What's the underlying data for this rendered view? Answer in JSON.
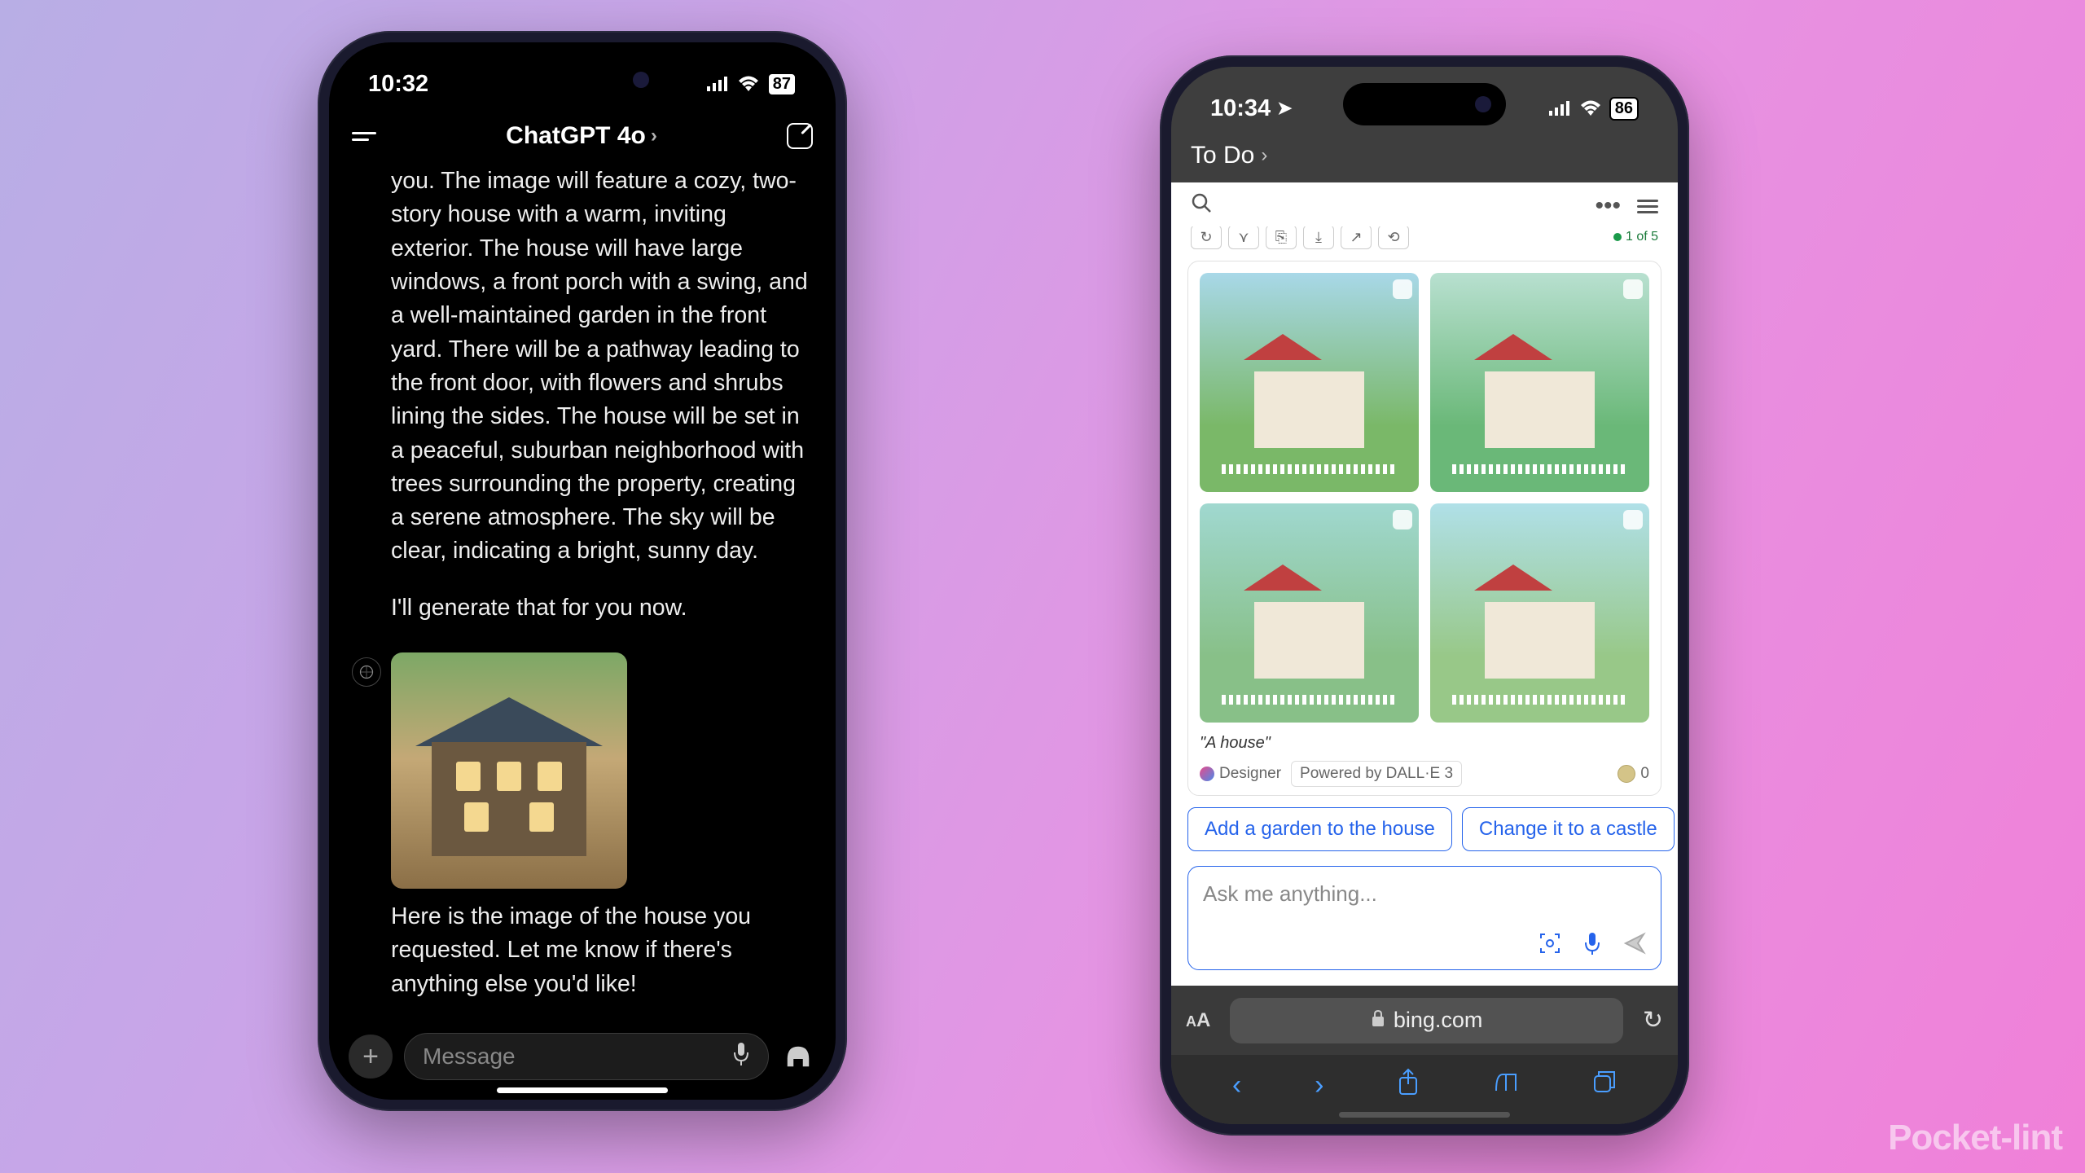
{
  "watermark": "Pocket-lint",
  "left": {
    "status": {
      "time": "10:32",
      "battery": "87"
    },
    "header": {
      "title": "ChatGPT 4o"
    },
    "message_body": "you. The image will feature a cozy, two-story house with a warm, inviting exterior. The house will have large windows, a front porch with a swing, and a well-maintained garden in the front yard. There will be a pathway leading to the front door, with flowers and shrubs lining the sides. The house will be set in a peaceful, suburban neighborhood with trees surrounding the property, creating a serene atmosphere. The sky will be clear, indicating a bright, sunny day.",
    "message_generate": "I'll generate that for you now.",
    "message_result": "Here is the image of the house you requested. Let me know if there's anything else you'd like!",
    "input": {
      "placeholder": "Message"
    }
  },
  "right": {
    "status": {
      "time": "10:34",
      "battery": "86"
    },
    "todo_label": "To Do",
    "counter": "1 of 5",
    "prompt_label": "\"A house\"",
    "designer_label": "Designer",
    "powered_label": "Powered by DALL·E 3",
    "coin_count": "0",
    "suggestions": [
      "Add a garden to the house",
      "Change it to a castle"
    ],
    "ask_placeholder": "Ask me anything...",
    "url": "bing.com",
    "aa": "AA"
  }
}
